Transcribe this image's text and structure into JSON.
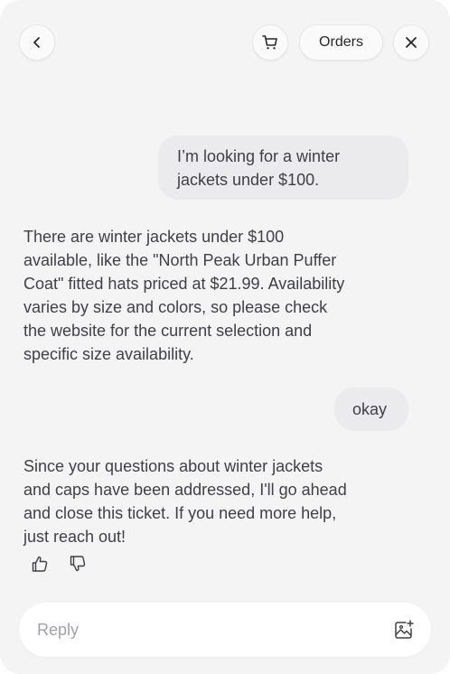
{
  "header": {
    "back_icon": "chevron-left-icon",
    "cart_icon": "cart-icon",
    "orders_label": "Orders",
    "close_icon": "close-icon"
  },
  "messages": [
    {
      "role": "user",
      "text": "I’m looking for a winter jackets under $100."
    },
    {
      "role": "assistant",
      "text": "There are winter jackets under $100 available, like the \"North Peak Urban Puffer Coat\" fitted hats priced at $21.99. Availability varies by size and colors, so please check the website for the current selection and specific size availability."
    },
    {
      "role": "user",
      "text": "okay"
    },
    {
      "role": "assistant",
      "text": "Since your questions about winter jackets and caps have been addressed, I'll go ahead and close this ticket. If you need more help, just reach out!"
    }
  ],
  "feedback": {
    "up_icon": "thumbs-up-icon",
    "down_icon": "thumbs-down-icon"
  },
  "composer": {
    "placeholder": "Reply",
    "value": "",
    "attach_icon": "image-add-icon"
  }
}
